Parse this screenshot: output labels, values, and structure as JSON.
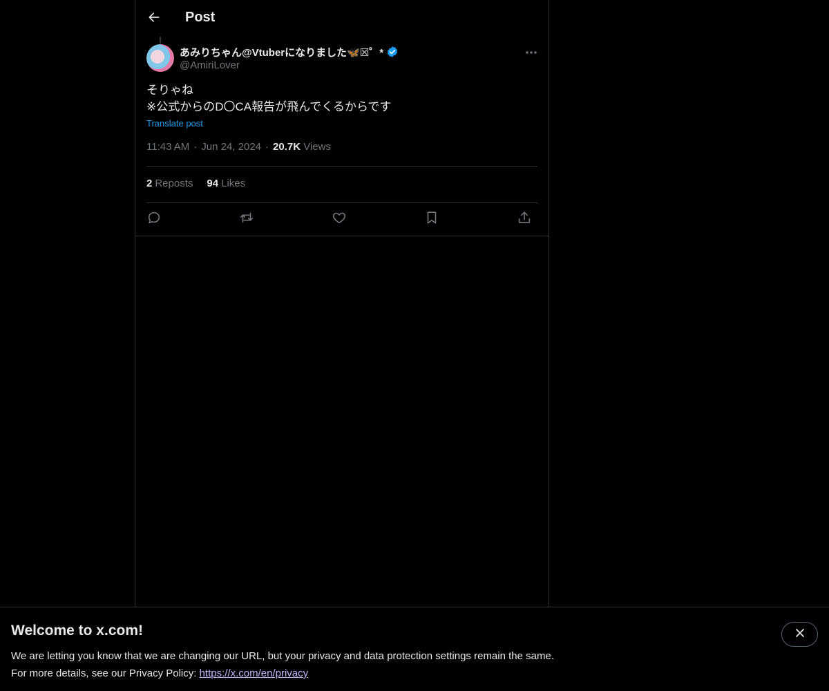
{
  "header": {
    "title": "Post"
  },
  "post": {
    "display_name": "あみりちゃん@Vtuberになりました🦋☒゜*",
    "handle": "@AmiriLover",
    "lines": [
      "そりゃね",
      "※公式からのD〇CA報告が飛んでくるからです"
    ],
    "translate_label": "Translate post",
    "time": "11:43 AM",
    "date": "Jun 24, 2024",
    "separator": "·",
    "views_count": "20.7K",
    "views_label": "Views",
    "reposts_count": "2",
    "reposts_label": "Reposts",
    "likes_count": "94",
    "likes_label": "Likes"
  },
  "icons": {
    "back": "arrow-left-icon",
    "verified": "verified-badge-icon",
    "more": "ellipsis-icon",
    "reply": "reply-icon",
    "repost": "repost-icon",
    "like": "heart-icon",
    "bookmark": "bookmark-icon",
    "share": "share-icon",
    "close": "close-icon"
  },
  "colors": {
    "background": "#000000",
    "accent": "#1d9bf0",
    "text": "#e7e9ea",
    "muted": "#71767b",
    "border": "#2f3336",
    "link": "#c4b5fd"
  },
  "banner": {
    "title": "Welcome to x.com!",
    "line1": "We are letting you know that we are changing our URL, but your privacy and data protection settings remain the same.",
    "line2_prefix": "For more details, see our Privacy Policy: ",
    "link": "https://x.com/en/privacy"
  }
}
